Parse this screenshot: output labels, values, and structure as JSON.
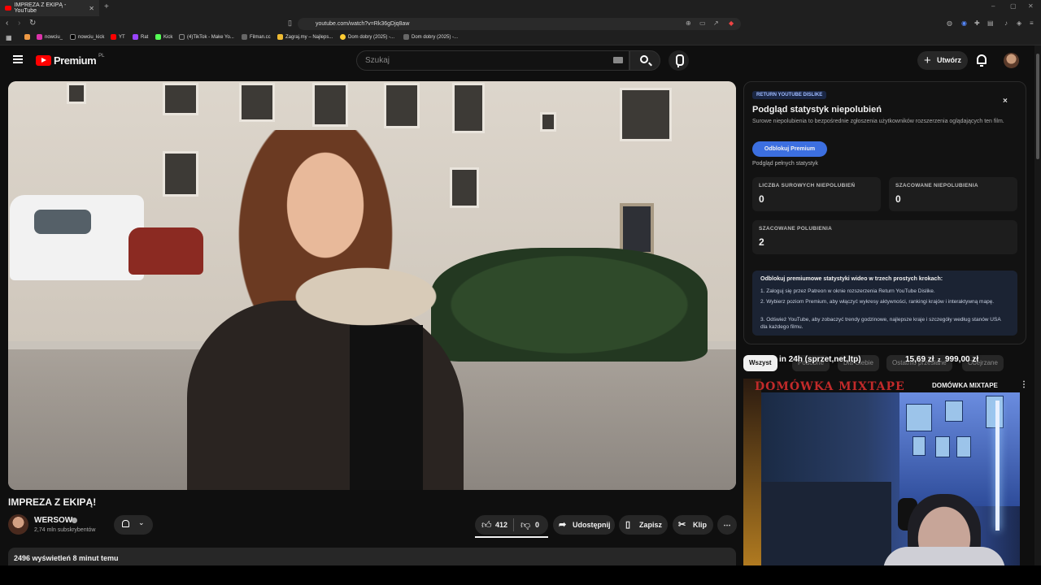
{
  "browser": {
    "tab_title": "IMPREZA Z EKIPĄ - YouTube",
    "new_tab": "+",
    "url": "youtube.com/watch?v=Rk36gDjq8aw",
    "bookmarks": [
      "nowciu_",
      "nowciu_kick",
      "YT",
      "Rat",
      "Kick",
      "(4)TikTok - Make Yo...",
      "Filman.cc",
      "Zagraj.my – Najleps...",
      "Dom dobry (2025) -...",
      "Dom dobry (2025) -..."
    ]
  },
  "header": {
    "logo_text": "Premium",
    "region": "PL",
    "search_placeholder": "Szukaj",
    "create_label": "Utwórz"
  },
  "video": {
    "title": "IMPREZA Z EKIPĄ!",
    "channel": "WERSOW",
    "subscribers": "2,74 mln subskrybentów",
    "likes": "412",
    "dislikes": "0",
    "share_label": "Udostępnij",
    "save_label": "Zapisz",
    "clip_label": "Klip",
    "views_time": "2496 wyświetleń  8 minut temu"
  },
  "ryd": {
    "tag": "RETURN YOUTUBE DISLIKE",
    "close": "×",
    "heading": "Podgląd statystyk niepolubień",
    "subtitle": "Surowe niepolubienia to bezpośrednie zgłoszenia użytkowników rozszerzenia oglądających ten film.",
    "unlock_button": "Odblokuj Premium",
    "preview_text": "Podgląd pełnych statystyk",
    "stats": [
      {
        "label": "LICZBA SUROWYCH NIEPOLUBIEŃ",
        "value": "0"
      },
      {
        "label": "SZACOWANE NIEPOLUBIENIA",
        "value": "0"
      },
      {
        "label": "SZACOWANE POLUBIENIA",
        "value": "2"
      }
    ],
    "steps_heading": "Odblokuj premiumowe statystyki wideo w trzech prostych krokach:",
    "steps": [
      "1.  Zaloguj się przez Patreon w oknie rozszerzenia Return YouTube Dislike.",
      "2.  Wybierz poziom Premium, aby włączyć wykresy aktywności, rankingi krajów i interaktywną mapę.",
      "3.  Odśwież YouTube, aby zobaczyć trendy godzinowe, najlepsze kraje i szczegóły według stanów USA dla każdego filmu."
    ]
  },
  "chips": {
    "items": [
      "Wszyst",
      "Podobne",
      "Dla Ciebie",
      "Ostatnio przesłane",
      "Obejrzane"
    ]
  },
  "overlay": {
    "left": "in 24h (sprzet,net,ltp)",
    "price1": "15,69 zł",
    "sep": "z",
    "price2": "999,00 zł"
  },
  "recommendation": {
    "art_text": "DOMÓWKA MIXTAPE",
    "title": "DOMÓWKA MIXTAPE",
    "more": "⋮"
  }
}
